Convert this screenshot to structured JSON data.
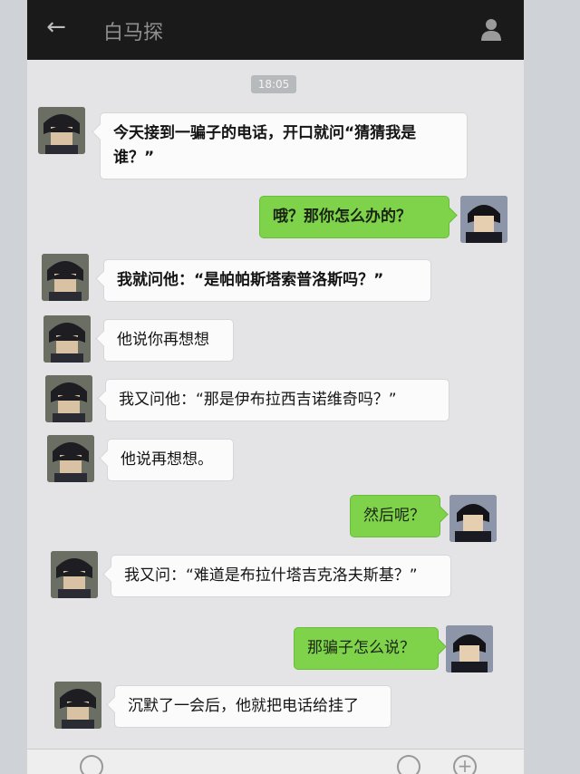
{
  "header": {
    "back_glyph": "←",
    "title": "白马探"
  },
  "timestamp": "18:05",
  "messages": [
    {
      "side": "in",
      "text": "今天接到一骗子的电话，开口就问“猜猜我是谁？”"
    },
    {
      "side": "out",
      "text": "哦？那你怎么办的？"
    },
    {
      "side": "in",
      "text": "我就问他：“是帕帕斯塔索普洛斯吗？”"
    },
    {
      "side": "in",
      "text": "他说你再想想"
    },
    {
      "side": "in",
      "text": "我又问他：“那是伊布拉西吉诺维奇吗？”"
    },
    {
      "side": "in",
      "text": "他说再想想。"
    },
    {
      "side": "out",
      "text": "然后呢？"
    },
    {
      "side": "in",
      "text": "我又问：“难道是布拉什塔吉克洛夫斯基？”"
    },
    {
      "side": "out",
      "text": "那骗子怎么说？"
    },
    {
      "side": "in",
      "text": "沉默了一会后，他就把电话给挂了"
    }
  ],
  "colors": {
    "header_bg": "#1a1a1a",
    "incoming_bubble": "#fbfbfb",
    "outgoing_bubble": "#7fd34a",
    "chat_bg": "#e4e4e6"
  },
  "icons": {
    "back": "back-arrow-icon",
    "profile": "person-icon",
    "voice": "voice-icon",
    "emoji": "emoji-icon",
    "plus": "plus-icon"
  }
}
